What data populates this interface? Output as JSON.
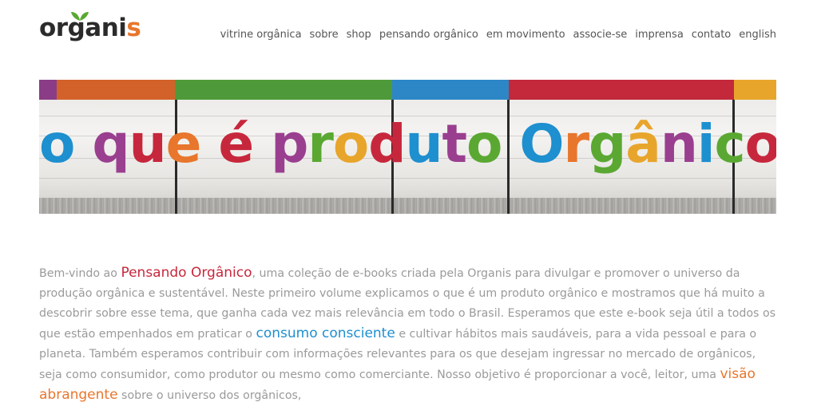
{
  "brand": {
    "logo_main": "organi",
    "logo_end": "s",
    "colors": {
      "dark": "#2b2b2b",
      "orange": "#e8762c",
      "leaf": "#5aa832"
    }
  },
  "nav": {
    "items": [
      "vitrine orgânica",
      "sobre",
      "shop",
      "pensando orgânico",
      "em movimento",
      "associe-se",
      "imprensa",
      "contato",
      "english"
    ]
  },
  "banner": {
    "headline_letters": [
      {
        "ch": "o",
        "color": "#1e8fcf"
      },
      {
        "ch": " ",
        "color": "#000"
      },
      {
        "ch": "q",
        "color": "#9a3f8f"
      },
      {
        "ch": "u",
        "color": "#c7273c"
      },
      {
        "ch": "e",
        "color": "#e8762c"
      },
      {
        "ch": " ",
        "color": "#000"
      },
      {
        "ch": "é",
        "color": "#c7273c"
      },
      {
        "ch": " ",
        "color": "#000"
      },
      {
        "ch": "p",
        "color": "#9a3f8f"
      },
      {
        "ch": "r",
        "color": "#5aa832"
      },
      {
        "ch": "o",
        "color": "#e8a52c"
      },
      {
        "ch": "d",
        "color": "#c7273c"
      },
      {
        "ch": "u",
        "color": "#1e8fcf"
      },
      {
        "ch": "t",
        "color": "#9a3f8f"
      },
      {
        "ch": "o",
        "color": "#5aa832"
      },
      {
        "ch": " ",
        "color": "#000"
      },
      {
        "ch": "O",
        "color": "#1e8fcf"
      },
      {
        "ch": "r",
        "color": "#e8762c"
      },
      {
        "ch": "g",
        "color": "#5aa832"
      },
      {
        "ch": "â",
        "color": "#e8a52c"
      },
      {
        "ch": "n",
        "color": "#9a3f8f"
      },
      {
        "ch": "i",
        "color": "#1e8fcf"
      },
      {
        "ch": "c",
        "color": "#5aa832"
      },
      {
        "ch": "o",
        "color": "#c7273c"
      },
      {
        "ch": "?",
        "color": "#e8a52c"
      }
    ],
    "stripe_colors": [
      "#8b3c86",
      "#d2622a",
      "#4e9a3a",
      "#2d87c6",
      "#c3283b",
      "#e8a52c"
    ]
  },
  "intro": {
    "t1": "Bem-vindo ao ",
    "h1": "Pensando Orgânico",
    "t2": ", uma coleção de e-books criada pela Organis para divulgar e promover o universo da produção orgânica e sustentável. Neste primeiro volume explicamos o que é um produto orgânico e mostramos que há muito a descobrir sobre esse tema, que ganha cada vez mais relevância em todo o Brasil. Esperamos que este e-book seja útil a todos os que estão empenhados em praticar o ",
    "h2": "consumo consciente",
    "t3": " e cultivar hábitos mais saudáveis, para a vida pessoal e para o planeta. Também esperamos contribuir com informações relevantes para os que desejam ingressar no mercado de orgânicos, seja como consumidor, como produtor ou mesmo como comerciante. Nosso objetivo é proporcionar a você, leitor, uma ",
    "h3": "visão abrangente",
    "t4": " sobre o universo dos orgânicos,"
  }
}
